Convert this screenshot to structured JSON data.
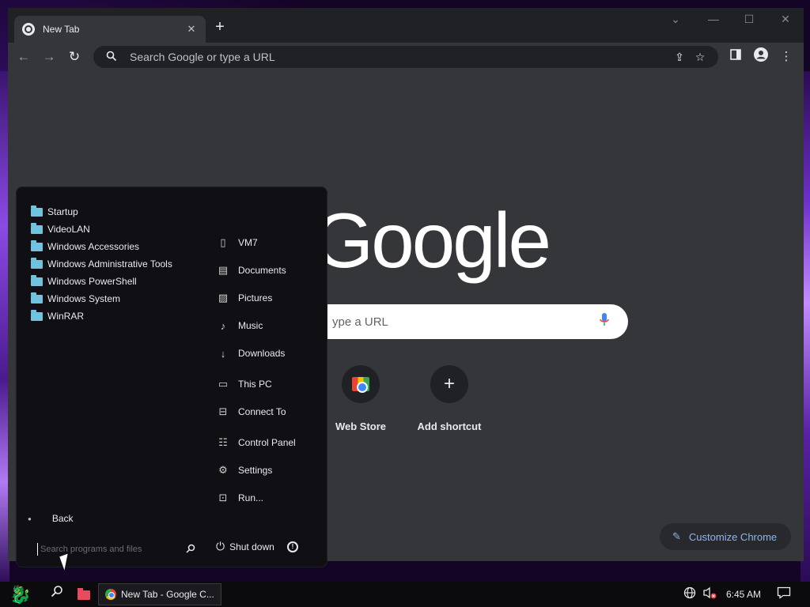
{
  "browser": {
    "tab_title": "New Tab",
    "tab_close": "✕",
    "new_tab": "+",
    "window_controls": [
      "⌄",
      "—",
      "☐",
      "✕"
    ],
    "nav": {
      "back": "←",
      "forward": "→",
      "reload": "↻"
    },
    "omnibox_placeholder": "Search Google or type a URL",
    "toolbar_icons": [
      "share-icon",
      "star-icon",
      "side-panel-icon",
      "profile-icon",
      "menu-icon"
    ]
  },
  "ntp": {
    "logo": "Google",
    "search_placeholder": "ype a URL",
    "shortcuts": [
      {
        "label": "Web Store",
        "icon": "web-store-icon"
      },
      {
        "label": "Add shortcut",
        "icon": "plus-icon"
      }
    ],
    "customize_label": "Customize Chrome"
  },
  "start_menu": {
    "folders": [
      "Startup",
      "VideoLAN",
      "Windows Accessories",
      "Windows Administrative Tools",
      "Windows PowerShell",
      "Windows System",
      "WinRAR"
    ],
    "right_items": [
      {
        "label": "VM7",
        "icon": "user-folder-icon"
      },
      {
        "label": "Documents",
        "icon": "documents-icon"
      },
      {
        "label": "Pictures",
        "icon": "pictures-icon"
      },
      {
        "label": "Music",
        "icon": "music-icon"
      },
      {
        "label": "Downloads",
        "icon": "downloads-icon"
      },
      {
        "label": "This PC",
        "icon": "computer-icon"
      },
      {
        "label": "Connect To",
        "icon": "connect-icon"
      },
      {
        "label": "Control Panel",
        "icon": "control-panel-icon"
      },
      {
        "label": "Settings",
        "icon": "settings-icon"
      },
      {
        "label": "Run...",
        "icon": "run-icon"
      }
    ],
    "back_label": "Back",
    "search_placeholder": "Search programs and files",
    "shutdown_label": "Shut down"
  },
  "taskbar": {
    "task_label": "New Tab - Google C...",
    "clock": "6:45 AM"
  },
  "colors": {
    "folder": "#6fc3df",
    "accent_link": "#8ab4f8",
    "browser_bg": "#35363a",
    "tabstrip_bg": "#202124"
  }
}
